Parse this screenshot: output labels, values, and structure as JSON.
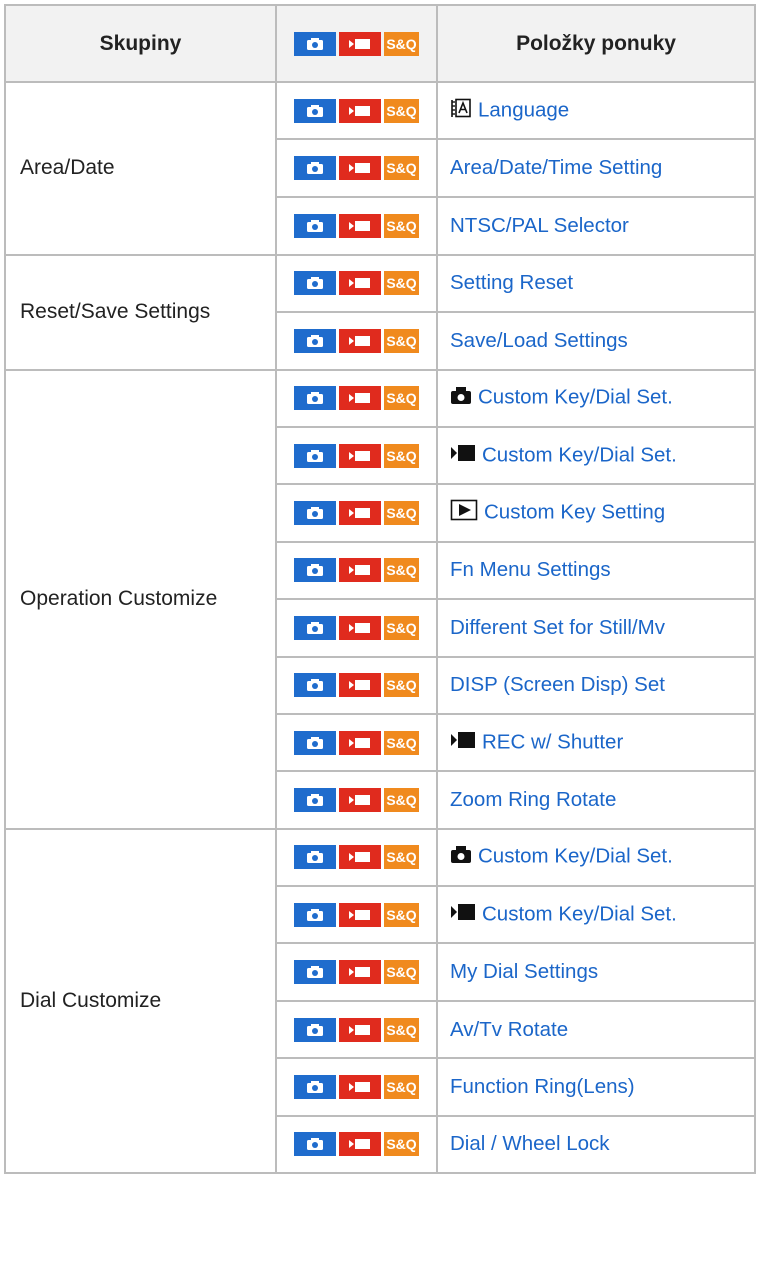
{
  "header": {
    "col1": "Skupiny",
    "col3": "Položky ponuky",
    "mode_badges": [
      "photo-mode-icon",
      "movie-mode-icon",
      "S&Q"
    ]
  },
  "colors": {
    "photo": "#1f6ccd",
    "movie": "#e02b1e",
    "sq": "#f08a1e",
    "link": "#1b66c9"
  },
  "groups": [
    {
      "name": "Area/Date",
      "items": [
        {
          "icon": "language-icon",
          "label": "Language"
        },
        {
          "icon": "",
          "label": "Area/Date/Time Setting"
        },
        {
          "icon": "",
          "label": "NTSC/PAL Selector"
        }
      ]
    },
    {
      "name": "Reset/Save Settings",
      "items": [
        {
          "icon": "",
          "label": "Setting Reset"
        },
        {
          "icon": "",
          "label": "Save/Load Settings"
        }
      ]
    },
    {
      "name": "Operation Customize",
      "items": [
        {
          "icon": "still-camera-icon",
          "label": "Custom Key/Dial Set."
        },
        {
          "icon": "movie-icon",
          "label": "Custom Key/Dial Set."
        },
        {
          "icon": "playback-icon",
          "label": "Custom Key Setting"
        },
        {
          "icon": "",
          "label": "Fn Menu Settings"
        },
        {
          "icon": "",
          "label": "Different Set for Still/Mv"
        },
        {
          "icon": "",
          "label": "DISP (Screen Disp) Set"
        },
        {
          "icon": "movie-icon",
          "label": "REC w/ Shutter"
        },
        {
          "icon": "",
          "label": "Zoom Ring Rotate"
        }
      ]
    },
    {
      "name": "Dial Customize",
      "items": [
        {
          "icon": "still-camera-icon",
          "label": "Custom Key/Dial Set."
        },
        {
          "icon": "movie-icon",
          "label": "Custom Key/Dial Set."
        },
        {
          "icon": "",
          "label": "My Dial Settings"
        },
        {
          "icon": "",
          "label": "Av/Tv Rotate"
        },
        {
          "icon": "",
          "label": "Function Ring(Lens)"
        },
        {
          "icon": "",
          "label": "Dial / Wheel Lock"
        }
      ]
    }
  ]
}
